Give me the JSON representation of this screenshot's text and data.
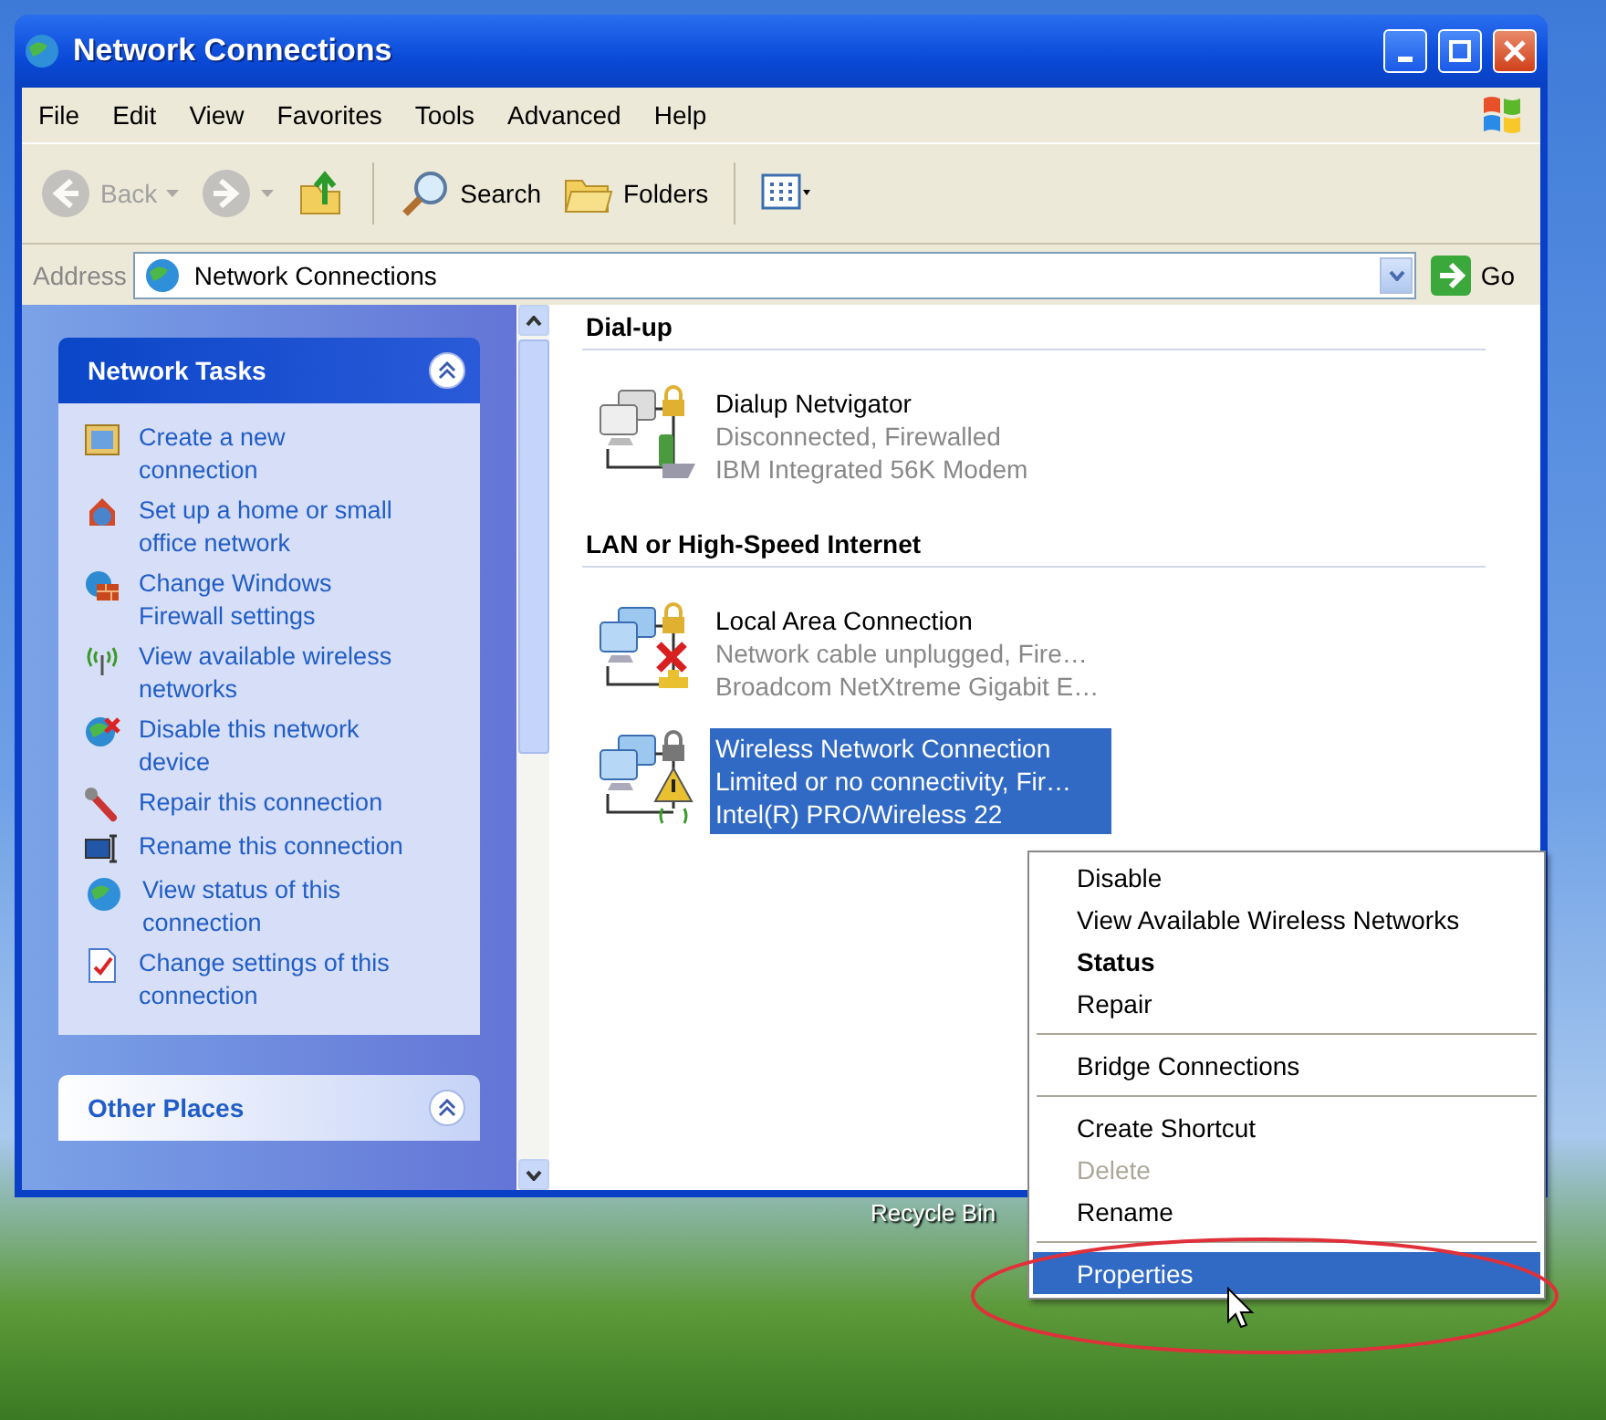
{
  "window": {
    "title": "Network Connections"
  },
  "menu": [
    "File",
    "Edit",
    "View",
    "Favorites",
    "Tools",
    "Advanced",
    "Help"
  ],
  "toolbar": [
    {
      "kind": "back",
      "label": "Back",
      "disabled": true
    },
    {
      "kind": "forward",
      "disabled": true
    },
    {
      "kind": "up",
      "disabled": false
    },
    {
      "kind": "search",
      "label": "Search",
      "disabled": false
    },
    {
      "kind": "folders",
      "label": "Folders",
      "disabled": false
    },
    {
      "kind": "views",
      "disabled": false
    }
  ],
  "address": {
    "label": "Address",
    "value": "Network Connections",
    "go": "Go"
  },
  "task_panes": [
    {
      "title": "Network Tasks",
      "items": [
        "Create a new connection",
        "Set up a home or small office network",
        "Change Windows Firewall settings",
        "View available wireless networks",
        "Disable this network device",
        "Repair this connection",
        "Rename this connection",
        "View status of this connection",
        "Change settings of this connection"
      ]
    },
    {
      "title": "Other Places"
    }
  ],
  "sections": [
    {
      "title": "Dial-up",
      "items": [
        {
          "kind": "dialup",
          "name": "Dialup Netvigator",
          "status": "Disconnected, Firewalled",
          "device": "IBM Integrated 56K Modem",
          "selected": false
        }
      ]
    },
    {
      "title": "LAN or High-Speed Internet",
      "items": [
        {
          "kind": "lan",
          "name": "Local Area Connection",
          "status": "Network cable unplugged, Fire…",
          "device": "Broadcom NetXtreme Gigabit E…",
          "selected": false
        },
        {
          "kind": "wireless",
          "name": "Wireless Network Connection",
          "status": "Limited or no connectivity, Fir…",
          "device": "Intel(R) PRO/Wireless 22",
          "selected": true
        }
      ]
    }
  ],
  "desktop_icons": [
    {
      "label": "Recycle Bin"
    }
  ],
  "context_menu": [
    {
      "kind": "item",
      "label": "Disable",
      "bold": false,
      "disabled": false,
      "selected": false
    },
    {
      "kind": "item",
      "label": "View Available Wireless Networks",
      "bold": false,
      "disabled": false,
      "selected": false
    },
    {
      "kind": "item",
      "label": "Status",
      "bold": true,
      "disabled": false,
      "selected": false
    },
    {
      "kind": "item",
      "label": "Repair",
      "bold": false,
      "disabled": false,
      "selected": false
    },
    {
      "kind": "separator"
    },
    {
      "kind": "item",
      "label": "Bridge Connections",
      "bold": false,
      "disabled": false,
      "selected": false
    },
    {
      "kind": "separator"
    },
    {
      "kind": "item",
      "label": "Create Shortcut",
      "bold": false,
      "disabled": false,
      "selected": false
    },
    {
      "kind": "item",
      "label": "Delete",
      "bold": false,
      "disabled": true,
      "selected": false
    },
    {
      "kind": "item",
      "label": "Rename",
      "bold": false,
      "disabled": false,
      "selected": false
    },
    {
      "kind": "separator"
    },
    {
      "kind": "item",
      "label": "Properties",
      "bold": false,
      "disabled": false,
      "selected": true
    }
  ]
}
